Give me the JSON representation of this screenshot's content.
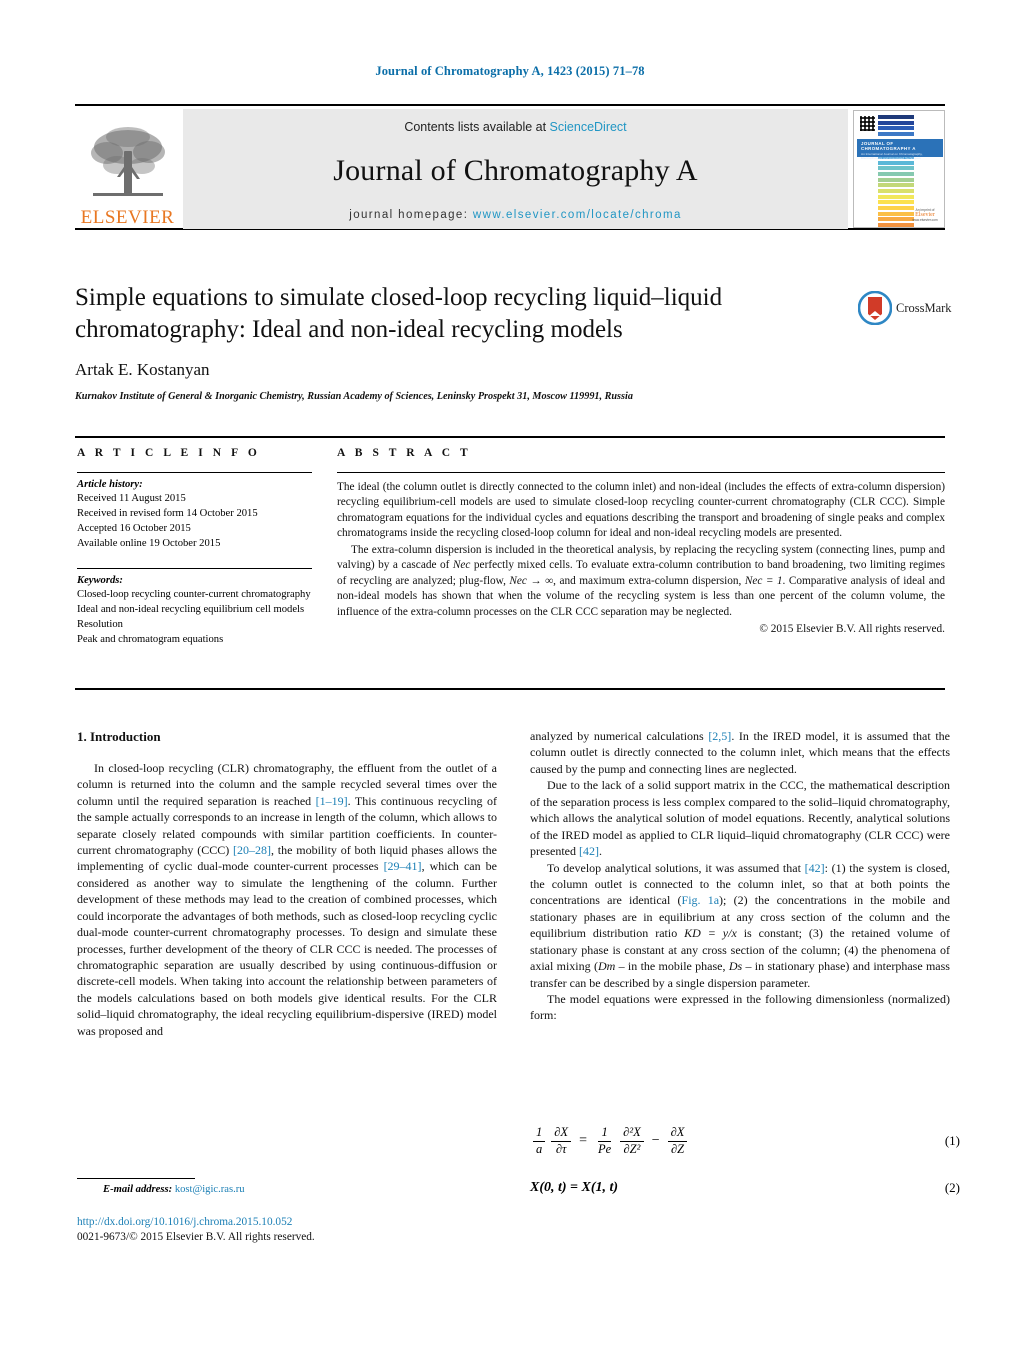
{
  "running_head": "Journal of Chromatography A, 1423 (2015) 71–78",
  "masthead": {
    "publisher_logo_name": "elsevier-tree-logo",
    "publisher_word": "ELSEVIER",
    "contents_prefix": "Contents lists available at ",
    "contents_link": "ScienceDirect",
    "journal_title": "Journal of Chromatography A",
    "homepage_prefix": "journal homepage: ",
    "homepage_url": "www.elsevier.com/locate/chroma",
    "cover": {
      "band_title": "JOURNAL OF CHROMATOGRAPHY A",
      "band_sub": "An International Journal on Chromatography, Electrophoresis and Associated Techniques",
      "logo_top": "An imprint of",
      "logo_mid": "Elsevier",
      "logo_bottom": "www.elsevier.com"
    }
  },
  "article": {
    "title": "Simple equations to simulate closed-loop recycling liquid–liquid chromatography: Ideal and non-ideal recycling models",
    "author": "Artak E. Kostanyan",
    "affiliation": "Kurnakov Institute of General & Inorganic Chemistry, Russian Academy of Sciences, Leninsky Prospekt 31, Moscow 119991, Russia",
    "crossmark_label": "CrossMark"
  },
  "article_info": {
    "heading": "A R T I C L E   I N F O",
    "history_label": "Article history:",
    "history": [
      "Received 11 August 2015",
      "Received in revised form 14 October 2015",
      "Accepted 16 October 2015",
      "Available online 19 October 2015"
    ],
    "keywords_label": "Keywords:",
    "keywords": [
      "Closed-loop recycling counter-current chromatography",
      "Ideal and non-ideal recycling equilibrium cell models",
      "Resolution",
      "Peak and chromatogram equations"
    ]
  },
  "abstract": {
    "heading": "A B S T R A C T",
    "paragraph1": "The ideal (the column outlet is directly connected to the column inlet) and non-ideal (includes the effects of extra-column dispersion) recycling equilibrium-cell models are used to simulate closed-loop recycling counter-current chromatography (CLR CCC). Simple chromatogram equations for the individual cycles and equations describing the transport and broadening of single peaks and complex chromatograms inside the recycling closed-loop column for ideal and non-ideal recycling models are presented.",
    "paragraph2_a": "The extra-column dispersion is included in the theoretical analysis, by replacing the recycling system (connecting lines, pump and valving) by a cascade of ",
    "paragraph2_sym1": "Nec",
    "paragraph2_b": " perfectly mixed cells. To evaluate extra-column contribution to band broadening, two limiting regimes of recycling are analyzed; plug-flow, ",
    "paragraph2_sym2": "Nec → ∞",
    "paragraph2_c": ", and maximum extra-column dispersion, ",
    "paragraph2_sym3": "Nec = 1",
    "paragraph2_d": ". Comparative analysis of ideal and non-ideal models has shown that when the volume of the recycling system is less than one percent of the column volume, the influence of the extra-column processes on the CLR CCC separation may be neglected.",
    "copyright": "© 2015 Elsevier B.V. All rights reserved."
  },
  "body": {
    "section_number_title": "1.  Introduction",
    "left_p1_a": "In closed-loop recycling (CLR) chromatography, the effluent from the outlet of a column is returned into the column and the sample recycled several times over the column until the required separation is reached ",
    "left_cite_1": "[1–19]",
    "left_p1_b": ". This continuous recycling of the sample actually corresponds to an increase in length of the column, which allows to separate closely related compounds with similar partition coefficients. In counter-current chromatography (CCC) ",
    "left_cite_2": "[20–28]",
    "left_p1_c": ", the mobility of both liquid phases allows the implementing of cyclic dual-mode counter-current processes ",
    "left_cite_3": "[29–41]",
    "left_p1_d": ", which can be considered as another way to simulate the lengthening of the column. Further development of these methods may lead to the creation of combined processes, which could incorporate the advantages of both methods, such as closed-loop recycling cyclic dual-mode counter-current chromatography processes. To design and simulate these processes, further development of the theory of CLR CCC is needed. The processes of chromatographic separation are usually described by using continuous-diffusion or discrete-cell models. When taking into account the relationship between parameters of the models calculations based on both models give identical results. For the CLR solid–liquid chromatography, the ideal recycling equilibrium-dispersive (IRED) model was proposed and",
    "right_p1_a": "analyzed by numerical calculations ",
    "right_cite_1": "[2,5]",
    "right_p1_b": ". In the IRED model, it is assumed that the column outlet is directly connected to the column inlet, which means that the effects caused by the pump and connecting lines are neglected.",
    "right_p2_a": "Due to the lack of a solid support matrix in the CCC, the mathematical description of the separation process is less complex compared to the solid–liquid chromatography, which allows the analytical solution of model equations. Recently, analytical solutions of the IRED model as applied to CLR liquid–liquid chromatography (CLR CCC) were presented ",
    "right_cite_2": "[42]",
    "right_p2_b": ".",
    "right_p3_a": "To develop analytical solutions, it was assumed that ",
    "right_cite_3": "[42]",
    "right_p3_b": ": (1) the system is closed, the column outlet is connected to the column inlet, so that at both points the concentrations are identical (",
    "right_figref": "Fig. 1a",
    "right_p3_c": "); (2) the concentrations in the mobile and stationary phases are in equilibrium at any cross section of the column and the equilibrium distribution ratio ",
    "right_sym_kd": "KD = y/x",
    "right_p3_d": " is constant; (3) the retained volume of stationary phase is constant at any cross section of the column; (4) the phenomena of axial mixing (",
    "right_sym_dm": "Dm",
    "right_p3_e": " – in the mobile phase, ",
    "right_sym_ds": "Ds",
    "right_p3_f": " – in stationary phase) and interphase mass transfer can be described by a single dispersion parameter.",
    "right_p4": "The model equations were expressed in the following dimensionless (normalized) form:"
  },
  "equations": {
    "eq1": {
      "lhs_num": "1",
      "lhs_den": "a",
      "d1_num": "∂X",
      "d1_den": "∂τ",
      "equals": "=",
      "r1_num": "1",
      "r1_den": "Pe",
      "d2_num": "∂²X",
      "d2_den": "∂Z²",
      "minus": "−",
      "d3_num": "∂X",
      "d3_den": "∂Z",
      "number": "(1)"
    },
    "eq2": {
      "expr": "X(0, t) = X(1, t)",
      "number": "(2)"
    }
  },
  "footer": {
    "email_label": "E-mail address:",
    "email": "kost@igic.ras.ru",
    "doi": "http://dx.doi.org/10.1016/j.chroma.2015.10.052",
    "issn_line": "0021-9673/© 2015 Elsevier B.V. All rights reserved."
  },
  "colors": {
    "link": "#1b7fb5",
    "journal_head": "#0b6ea8",
    "sciencedirect": "#2196c4",
    "elsevier_orange": "#e87722"
  }
}
